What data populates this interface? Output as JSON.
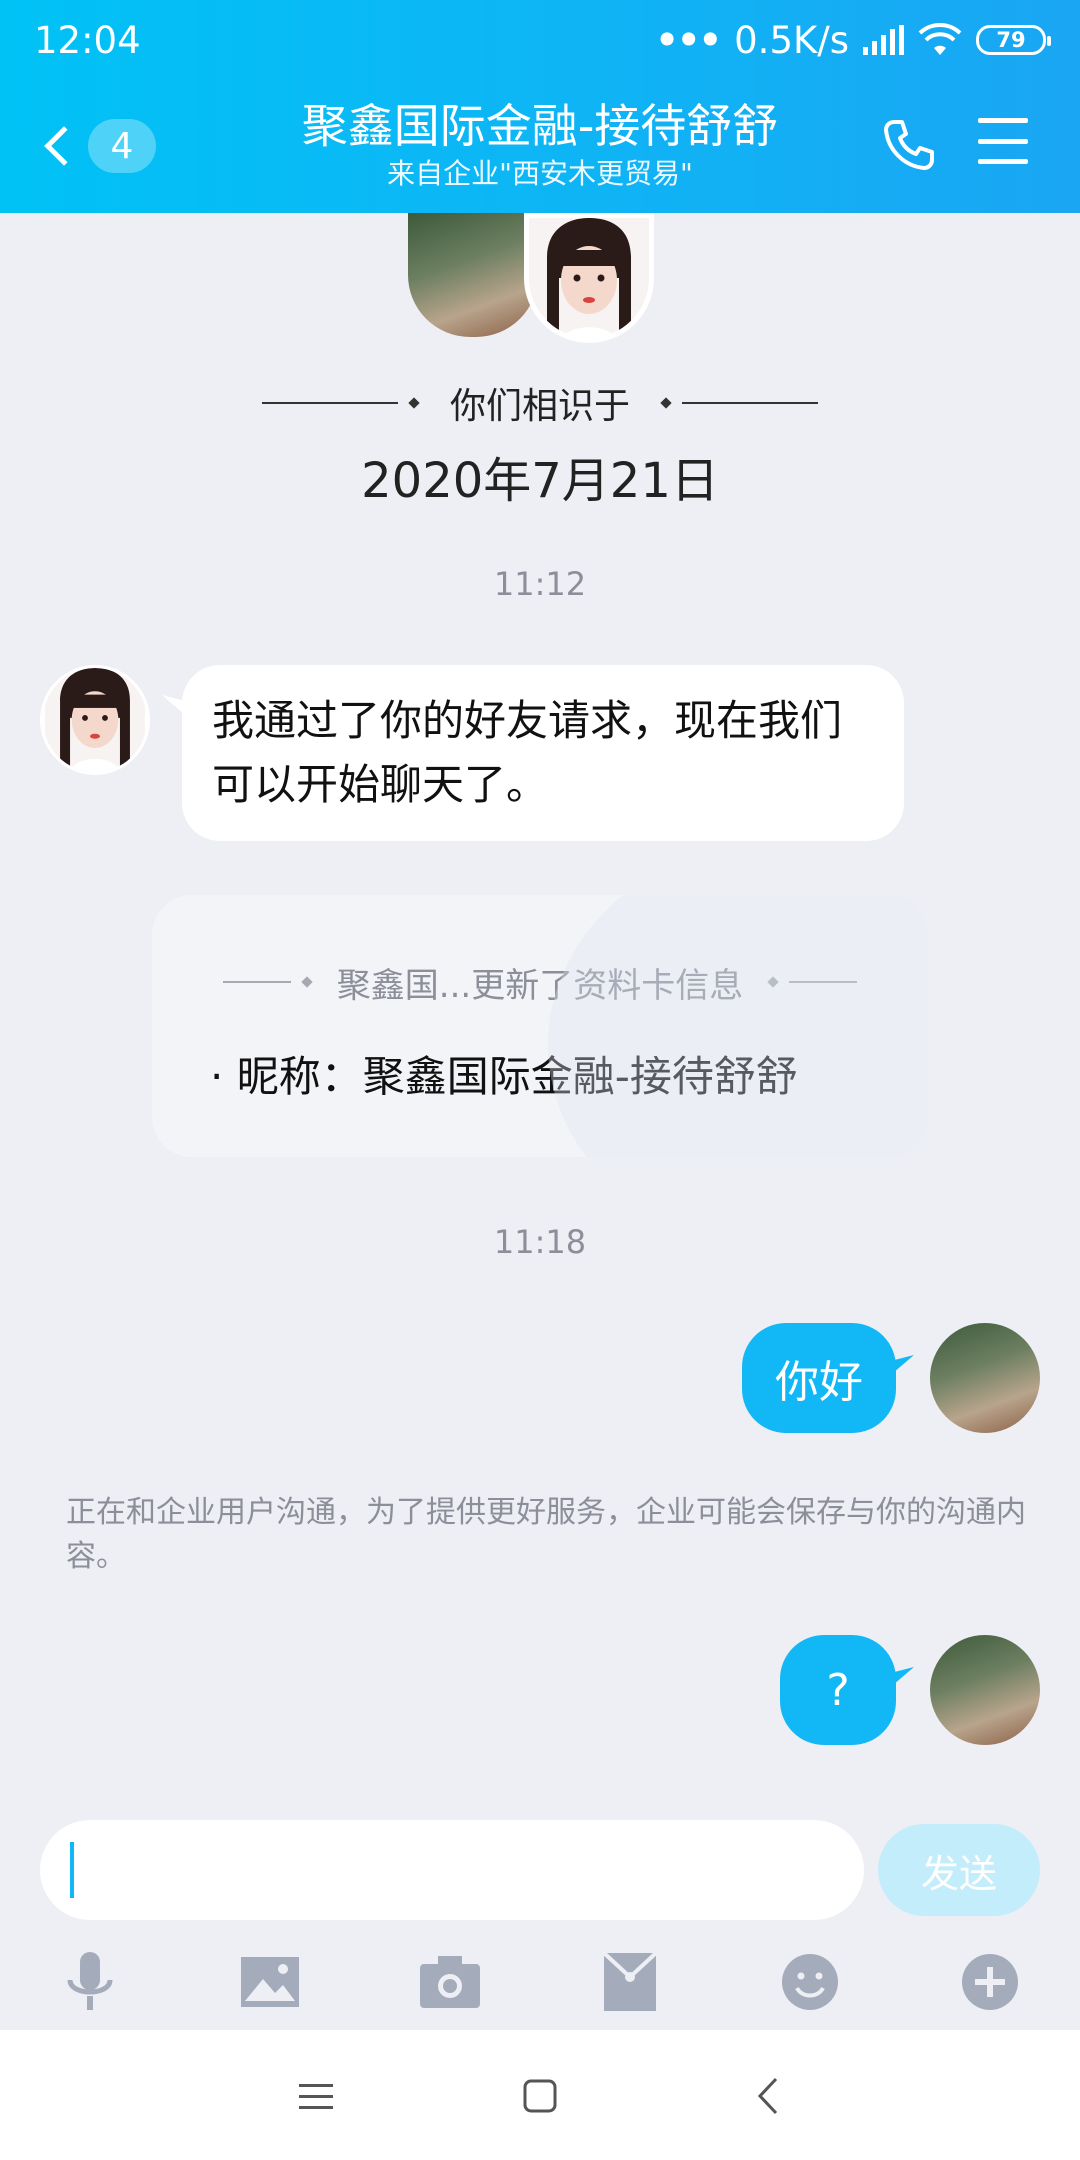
{
  "status_bar": {
    "time": "12:04",
    "net_dots": "•••",
    "net_speed": "0.5K/s",
    "battery": "79"
  },
  "header": {
    "back_badge": "4",
    "title": "聚鑫国际金融-接待舒舒",
    "subtitle": "来自企业\"西安木更贸易\""
  },
  "chat": {
    "met_text": "你们相识于",
    "met_date": "2020年7月21日",
    "messages": [
      {
        "time": "11:12"
      },
      {
        "text": "我通过了你的好友请求，现在我们可以开始聊天了。"
      },
      {
        "card_title": "聚鑫国...更新了资料卡信息",
        "card_body": "· 昵称：聚鑫国际金融-接待舒舒"
      },
      {
        "time": "11:18"
      },
      {
        "text": "你好"
      },
      {
        "notice": "正在和企业用户沟通，为了提供更好服务，企业可能会保存与你的沟通内容。"
      },
      {
        "text": "?"
      }
    ]
  },
  "input": {
    "value": "",
    "send_label": "发送"
  },
  "toolbar": {
    "icons": [
      "microphone-icon",
      "image-icon",
      "camera-icon",
      "red-packet-icon",
      "emoji-icon",
      "plus-icon"
    ]
  },
  "system_nav": {
    "icons": [
      "menu-icon",
      "home-icon",
      "back-icon"
    ]
  },
  "colors": {
    "header_start": "#00c2f5",
    "header_end": "#1aa6f3",
    "bubble_me": "#12b7f5",
    "chat_bg": "#edeff4"
  }
}
